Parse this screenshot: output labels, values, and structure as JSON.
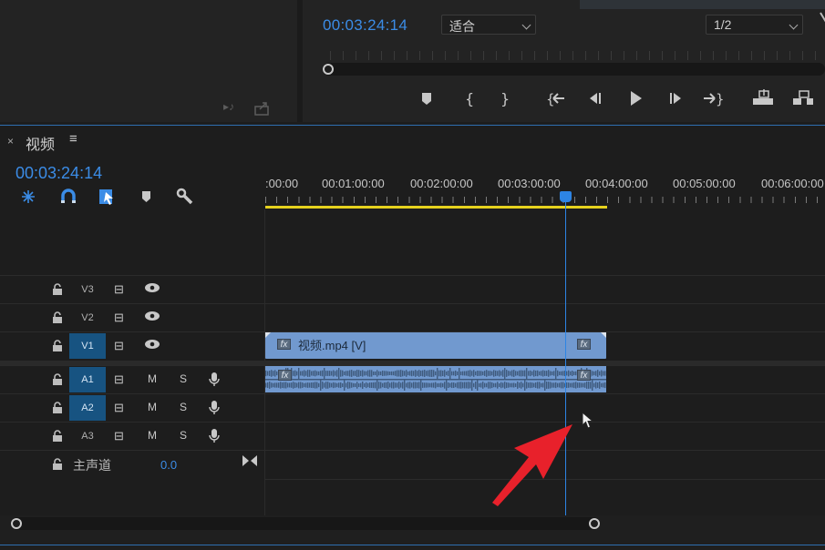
{
  "program_monitor": {
    "timecode": "00:03:24:14",
    "fit_select": "适合",
    "resolution_select": "1/2",
    "transport": [
      {
        "name": "add-marker",
        "glyph": "⬟"
      },
      {
        "name": "mark-in",
        "glyph": "{"
      },
      {
        "name": "mark-out",
        "glyph": "}"
      },
      {
        "name": "go-to-in",
        "glyph": "{⇤"
      },
      {
        "name": "step-back",
        "glyph": "◀|"
      },
      {
        "name": "play",
        "glyph": "▶"
      },
      {
        "name": "step-forward",
        "glyph": "|▶"
      },
      {
        "name": "go-to-out",
        "glyph": "⇥}"
      },
      {
        "name": "lift",
        "glyph": "lift"
      },
      {
        "name": "extract",
        "glyph": "extract"
      }
    ]
  },
  "timeline": {
    "title": "视频",
    "close": "×",
    "menu": "≡",
    "timecode": "00:03:24:14",
    "ruler_labels": [
      ":00:00",
      "00:01:00:00",
      "00:02:00:00",
      "00:03:00:00",
      "00:04:00:00",
      "00:05:00:00",
      "00:06:00:00"
    ],
    "video_tracks": [
      {
        "name": "V3",
        "active": false
      },
      {
        "name": "V2",
        "active": false
      },
      {
        "name": "V1",
        "active": true
      }
    ],
    "audio_tracks": [
      {
        "name": "A1",
        "active": true,
        "m": "M",
        "s": "S"
      },
      {
        "name": "A2",
        "active": true,
        "m": "M",
        "s": "S"
      },
      {
        "name": "A3",
        "active": false,
        "m": "M",
        "s": "S"
      }
    ],
    "master": {
      "label": "主声道",
      "value": "0.0"
    },
    "video_clip": {
      "label": "视频.mp4 [V]",
      "fx": "fx"
    },
    "audio_clip": {
      "fx": "fx"
    }
  },
  "colors": {
    "accent": "#3b8ce6",
    "clip": "#7199cf",
    "work_area": "#e6d21e",
    "active_track": "#175381",
    "annotation_arrow": "#e8212b"
  }
}
